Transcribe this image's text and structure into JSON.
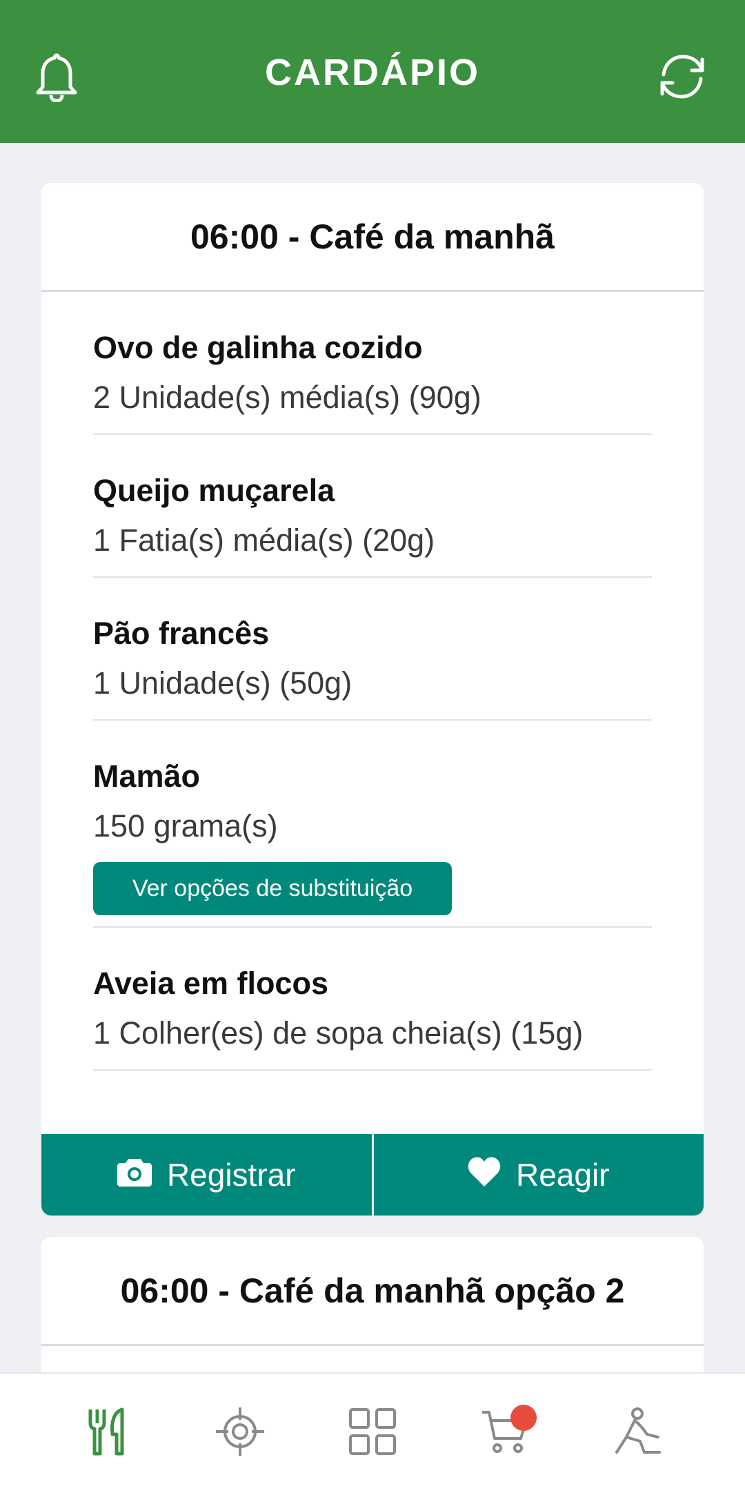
{
  "header": {
    "title": "CARDÁPIO",
    "left_icon": "bell-icon",
    "right_icon": "refresh-icon",
    "background_color": "#3b9140"
  },
  "meals": [
    {
      "title": "06:00 - Café da manhã",
      "items": [
        {
          "name": "Ovo de galinha cozido",
          "quantity": "2 Unidade(s) média(s) (90g)"
        },
        {
          "name": "Queijo muçarela",
          "quantity": "1 Fatia(s) média(s) (20g)"
        },
        {
          "name": "Pão francês",
          "quantity": "1 Unidade(s) (50g)"
        },
        {
          "name": "Mamão",
          "quantity": "150 grama(s)",
          "substitution_label": "Ver opções de substituição"
        },
        {
          "name": "Aveia em flocos",
          "quantity": "1 Colher(es) de sopa cheia(s) (15g)"
        }
      ],
      "actions": {
        "register_label": "Registrar",
        "react_label": "Reagir"
      }
    },
    {
      "title": "06:00 - Café da manhã opção 2"
    }
  ],
  "bottom_nav": {
    "items": [
      "cutlery-icon",
      "target-icon",
      "grid-icon",
      "cart-icon",
      "workout-icon"
    ],
    "active_color": "#3b9140",
    "inactive_color": "#8a8a8a",
    "badge_color": "#e74c3c"
  },
  "accent_color": "#00897b"
}
